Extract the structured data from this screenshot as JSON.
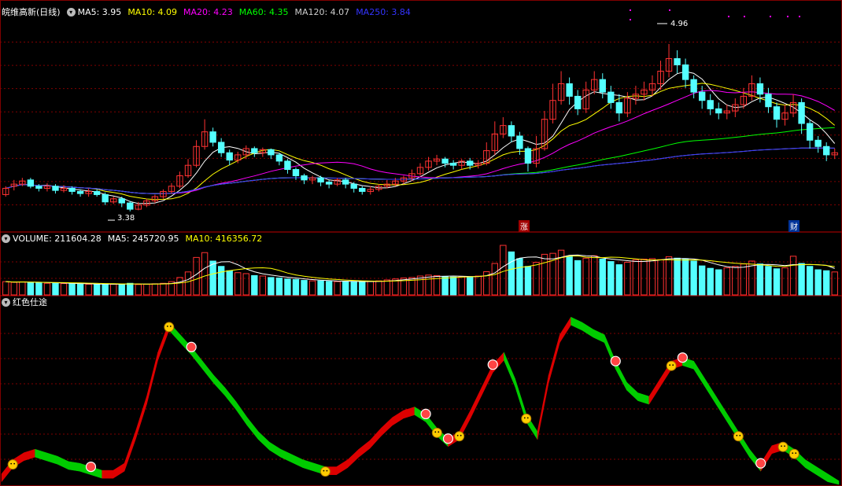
{
  "header": {
    "stock_name": "皖维高新(日线)",
    "ma": [
      {
        "label": "MA5: ",
        "value": "3.95",
        "color": "#ffffff"
      },
      {
        "label": "MA10: ",
        "value": "4.09",
        "color": "#ffff00"
      },
      {
        "label": "MA20: ",
        "value": "4.23",
        "color": "#ff00ff"
      },
      {
        "label": "MA60: ",
        "value": "4.35",
        "color": "#00ff00"
      },
      {
        "label": "MA120: ",
        "value": "4.07",
        "color": "#cccccc"
      },
      {
        "label": "MA250: ",
        "value": "3.84",
        "color": "#3333ff"
      }
    ]
  },
  "volume_header": {
    "volume": {
      "label": "VOLUME: ",
      "value": "211604.28",
      "color": "#ffffff"
    },
    "ma5": {
      "label": "MA5: ",
      "value": "245720.95",
      "color": "#ffffff"
    },
    "ma10": {
      "label": "MA10: ",
      "value": "416356.72",
      "color": "#ffff00"
    }
  },
  "indicator_header": {
    "label": "红色仕途"
  },
  "markers": {
    "high_label": "4.96",
    "low_label": "3.38",
    "tag_zhang": "涨",
    "tag_cai": "财"
  },
  "colors": {
    "up": "#ff3232",
    "down": "#54ffff",
    "bg": "#000000",
    "grid": "#800000",
    "ind_red": "#dd0000",
    "ind_green": "#00cc00"
  },
  "chart_data": [
    {
      "type": "candlestick",
      "name": "price",
      "ylim": [
        3.2,
        5.2
      ],
      "candles": [
        [
          3.52,
          3.58,
          3.5,
          3.6
        ],
        [
          3.6,
          3.62,
          3.56,
          3.66
        ],
        [
          3.62,
          3.65,
          3.6,
          3.68
        ],
        [
          3.66,
          3.6,
          3.58,
          3.68
        ],
        [
          3.6,
          3.58,
          3.55,
          3.62
        ],
        [
          3.58,
          3.6,
          3.55,
          3.63
        ],
        [
          3.6,
          3.56,
          3.53,
          3.62
        ],
        [
          3.56,
          3.58,
          3.54,
          3.61
        ],
        [
          3.58,
          3.55,
          3.52,
          3.6
        ],
        [
          3.55,
          3.53,
          3.5,
          3.57
        ],
        [
          3.53,
          3.55,
          3.5,
          3.58
        ],
        [
          3.55,
          3.52,
          3.5,
          3.57
        ],
        [
          3.52,
          3.45,
          3.42,
          3.54
        ],
        [
          3.45,
          3.48,
          3.43,
          3.5
        ],
        [
          3.48,
          3.44,
          3.4,
          3.5
        ],
        [
          3.44,
          3.38,
          3.36,
          3.46
        ],
        [
          3.38,
          3.42,
          3.37,
          3.45
        ],
        [
          3.42,
          3.46,
          3.4,
          3.48
        ],
        [
          3.46,
          3.5,
          3.44,
          3.52
        ],
        [
          3.5,
          3.55,
          3.48,
          3.57
        ],
        [
          3.55,
          3.6,
          3.53,
          3.63
        ],
        [
          3.6,
          3.7,
          3.58,
          3.74
        ],
        [
          3.7,
          3.8,
          3.68,
          3.86
        ],
        [
          3.8,
          3.98,
          3.78,
          4.04
        ],
        [
          3.98,
          4.12,
          3.95,
          4.24
        ],
        [
          4.12,
          4.02,
          3.98,
          4.16
        ],
        [
          4.02,
          3.92,
          3.88,
          4.06
        ],
        [
          3.92,
          3.85,
          3.8,
          3.95
        ],
        [
          3.85,
          3.9,
          3.82,
          3.93
        ],
        [
          3.9,
          3.96,
          3.86,
          3.99
        ],
        [
          3.96,
          3.92,
          3.88,
          3.98
        ],
        [
          3.92,
          3.95,
          3.88,
          3.97
        ],
        [
          3.95,
          3.9,
          3.86,
          3.96
        ],
        [
          3.9,
          3.84,
          3.8,
          3.92
        ],
        [
          3.84,
          3.76,
          3.72,
          3.86
        ],
        [
          3.76,
          3.7,
          3.66,
          3.78
        ],
        [
          3.7,
          3.66,
          3.62,
          3.72
        ],
        [
          3.66,
          3.68,
          3.62,
          3.7
        ],
        [
          3.68,
          3.64,
          3.6,
          3.7
        ],
        [
          3.64,
          3.62,
          3.58,
          3.66
        ],
        [
          3.62,
          3.66,
          3.6,
          3.68
        ],
        [
          3.66,
          3.62,
          3.58,
          3.68
        ],
        [
          3.62,
          3.58,
          3.54,
          3.64
        ],
        [
          3.58,
          3.55,
          3.52,
          3.6
        ],
        [
          3.55,
          3.57,
          3.52,
          3.6
        ],
        [
          3.57,
          3.6,
          3.55,
          3.62
        ],
        [
          3.6,
          3.62,
          3.58,
          3.66
        ],
        [
          3.62,
          3.65,
          3.6,
          3.68
        ],
        [
          3.65,
          3.68,
          3.62,
          3.7
        ],
        [
          3.68,
          3.72,
          3.65,
          3.76
        ],
        [
          3.72,
          3.78,
          3.7,
          3.82
        ],
        [
          3.78,
          3.84,
          3.75,
          3.88
        ],
        [
          3.84,
          3.86,
          3.8,
          3.9
        ],
        [
          3.86,
          3.82,
          3.78,
          3.88
        ],
        [
          3.82,
          3.8,
          3.76,
          3.85
        ],
        [
          3.8,
          3.84,
          3.76,
          3.86
        ],
        [
          3.84,
          3.8,
          3.76,
          3.87
        ],
        [
          3.8,
          3.82,
          3.77,
          3.85
        ],
        [
          3.82,
          3.94,
          3.8,
          4.02
        ],
        [
          3.94,
          4.1,
          3.9,
          4.22
        ],
        [
          4.1,
          4.18,
          4.06,
          4.26
        ],
        [
          4.18,
          4.08,
          4.02,
          4.22
        ],
        [
          4.08,
          3.96,
          3.9,
          4.12
        ],
        [
          3.96,
          3.82,
          3.74,
          3.98
        ],
        [
          3.82,
          3.96,
          3.78,
          4.08
        ],
        [
          3.96,
          4.24,
          3.94,
          4.32
        ],
        [
          4.24,
          4.42,
          4.2,
          4.58
        ],
        [
          4.42,
          4.58,
          4.38,
          4.7
        ],
        [
          4.58,
          4.46,
          4.38,
          4.64
        ],
        [
          4.46,
          4.34,
          4.28,
          4.52
        ],
        [
          4.34,
          4.52,
          4.3,
          4.6
        ],
        [
          4.52,
          4.62,
          4.48,
          4.7
        ],
        [
          4.62,
          4.5,
          4.44,
          4.68
        ],
        [
          4.5,
          4.4,
          4.34,
          4.56
        ],
        [
          4.4,
          4.3,
          4.22,
          4.48
        ],
        [
          4.3,
          4.44,
          4.26,
          4.5
        ],
        [
          4.44,
          4.48,
          4.38,
          4.56
        ],
        [
          4.48,
          4.52,
          4.42,
          4.6
        ],
        [
          4.52,
          4.58,
          4.46,
          4.66
        ],
        [
          4.58,
          4.7,
          4.52,
          4.8
        ],
        [
          4.7,
          4.82,
          4.64,
          4.96
        ],
        [
          4.82,
          4.76,
          4.68,
          4.9
        ],
        [
          4.76,
          4.62,
          4.54,
          4.82
        ],
        [
          4.62,
          4.5,
          4.44,
          4.66
        ],
        [
          4.5,
          4.42,
          4.34,
          4.56
        ],
        [
          4.42,
          4.34,
          4.28,
          4.48
        ],
        [
          4.34,
          4.3,
          4.24,
          4.4
        ],
        [
          4.3,
          4.32,
          4.24,
          4.38
        ],
        [
          4.32,
          4.38,
          4.26,
          4.44
        ],
        [
          4.38,
          4.46,
          4.34,
          4.54
        ],
        [
          4.46,
          4.58,
          4.42,
          4.66
        ],
        [
          4.58,
          4.48,
          4.4,
          4.64
        ],
        [
          4.48,
          4.36,
          4.3,
          4.54
        ],
        [
          4.36,
          4.24,
          4.16,
          4.4
        ],
        [
          4.24,
          4.3,
          4.18,
          4.38
        ],
        [
          4.3,
          4.4,
          4.26,
          4.48
        ],
        [
          4.4,
          4.2,
          4.1,
          4.44
        ],
        [
          4.2,
          4.04,
          3.96,
          4.24
        ],
        [
          4.04,
          3.98,
          3.92,
          4.08
        ],
        [
          3.98,
          3.9,
          3.84,
          4.02
        ],
        [
          3.9,
          3.92,
          3.86,
          3.96
        ]
      ]
    },
    {
      "type": "bar",
      "name": "volume",
      "values": [
        55,
        52,
        54,
        50,
        51,
        48,
        49,
        47,
        46,
        45,
        44,
        43,
        46,
        44,
        45,
        48,
        43,
        44,
        46,
        48,
        55,
        72,
        95,
        155,
        175,
        140,
        118,
        100,
        92,
        88,
        80,
        78,
        72,
        70,
        66,
        64,
        60,
        58,
        58,
        56,
        55,
        56,
        55,
        54,
        56,
        58,
        62,
        66,
        70,
        72,
        78,
        82,
        80,
        76,
        74,
        76,
        74,
        78,
        96,
        130,
        205,
        178,
        150,
        118,
        135,
        168,
        172,
        185,
        160,
        142,
        152,
        162,
        148,
        138,
        125,
        135,
        145,
        148,
        150,
        146,
        158,
        152,
        148,
        140,
        120,
        110,
        104,
        112,
        118,
        128,
        140,
        128,
        118,
        108,
        112,
        160,
        130,
        118,
        104,
        100,
        95
      ]
    },
    {
      "type": "area",
      "name": "红色仕途",
      "values": [
        0.06,
        0.14,
        0.18,
        0.2,
        0.18,
        0.16,
        0.13,
        0.12,
        0.1,
        0.08,
        0.08,
        0.12,
        0.3,
        0.5,
        0.75,
        0.92,
        0.85,
        0.78,
        0.7,
        0.62,
        0.55,
        0.47,
        0.38,
        0.3,
        0.24,
        0.2,
        0.17,
        0.14,
        0.12,
        0.1,
        0.1,
        0.14,
        0.2,
        0.25,
        0.32,
        0.38,
        0.42,
        0.44,
        0.4,
        0.32,
        0.26,
        0.3,
        0.42,
        0.55,
        0.68,
        0.75,
        0.6,
        0.4,
        0.3,
        0.62,
        0.85,
        0.95,
        0.92,
        0.88,
        0.85,
        0.7,
        0.58,
        0.52,
        0.5,
        0.6,
        0.7,
        0.72,
        0.7,
        0.6,
        0.5,
        0.4,
        0.3,
        0.2,
        0.12,
        0.22,
        0.24,
        0.2,
        0.14,
        0.1,
        0.06,
        0.02
      ],
      "signals": [
        {
          "i": 1,
          "kind": "face"
        },
        {
          "i": 8,
          "kind": "ball"
        },
        {
          "i": 15,
          "kind": "face"
        },
        {
          "i": 17,
          "kind": "ball"
        },
        {
          "i": 29,
          "kind": "face"
        },
        {
          "i": 38,
          "kind": "ball"
        },
        {
          "i": 39,
          "kind": "face"
        },
        {
          "i": 40,
          "kind": "ball"
        },
        {
          "i": 41,
          "kind": "face"
        },
        {
          "i": 44,
          "kind": "ball"
        },
        {
          "i": 47,
          "kind": "face"
        },
        {
          "i": 55,
          "kind": "ball"
        },
        {
          "i": 60,
          "kind": "face"
        },
        {
          "i": 61,
          "kind": "ball"
        },
        {
          "i": 66,
          "kind": "face"
        },
        {
          "i": 68,
          "kind": "ball"
        },
        {
          "i": 70,
          "kind": "face"
        },
        {
          "i": 71,
          "kind": "face"
        }
      ]
    }
  ]
}
